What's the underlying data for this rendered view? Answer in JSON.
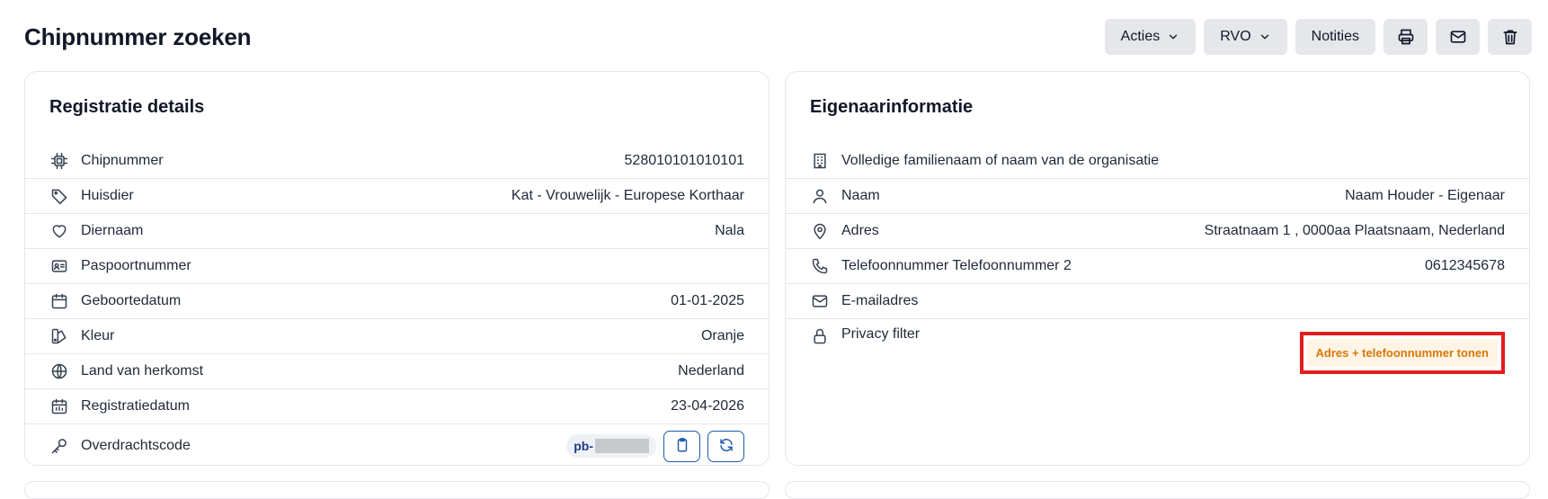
{
  "header": {
    "title": "Chipnummer zoeken",
    "acties_label": "Acties",
    "rvo_label": "RVO",
    "notities_label": "Notities"
  },
  "registration": {
    "title": "Registratie details",
    "rows": [
      {
        "icon": "chip-icon",
        "label": "Chipnummer",
        "value": "528010101010101"
      },
      {
        "icon": "tag-icon",
        "label": "Huisdier",
        "value": "Kat - Vrouwelijk - Europese Korthaar"
      },
      {
        "icon": "heart-icon",
        "label": "Diernaam",
        "value": "Nala"
      },
      {
        "icon": "id-card-icon",
        "label": "Paspoortnummer",
        "value": ""
      },
      {
        "icon": "calendar-icon",
        "label": "Geboortedatum",
        "value": "01-01-2025"
      },
      {
        "icon": "palette-icon",
        "label": "Kleur",
        "value": "Oranje"
      },
      {
        "icon": "globe-icon",
        "label": "Land van herkomst",
        "value": "Nederland"
      },
      {
        "icon": "calendar-grid-icon",
        "label": "Registratiedatum",
        "value": "23-04-2026"
      },
      {
        "icon": "key-icon",
        "label": "Overdrachtscode",
        "value": "pb-"
      }
    ]
  },
  "owner": {
    "title": "Eigenaarinformatie",
    "rows": [
      {
        "icon": "building-icon",
        "label": "Volledige familienaam of naam van de organisatie",
        "value": ""
      },
      {
        "icon": "user-icon",
        "label": "Naam",
        "value": "Naam Houder - Eigenaar"
      },
      {
        "icon": "map-pin-icon",
        "label": "Adres",
        "value": "Straatnaam 1 , 0000aa Plaatsnaam, Nederland"
      },
      {
        "icon": "phone-icon",
        "label": "Telefoonnummer Telefoonnummer 2",
        "value": "0612345678"
      },
      {
        "icon": "mail-icon",
        "label": "E-mailadres",
        "value": ""
      },
      {
        "icon": "lock-icon",
        "label": "Privacy filter",
        "value": ""
      }
    ],
    "privacy_badge": "Adres + telefoonnummer tonen"
  },
  "colors": {
    "accent": "#1e5aa8",
    "badge_text": "#d97706",
    "badge_bg": "#fff4e6",
    "highlight": "#e11d1d"
  }
}
